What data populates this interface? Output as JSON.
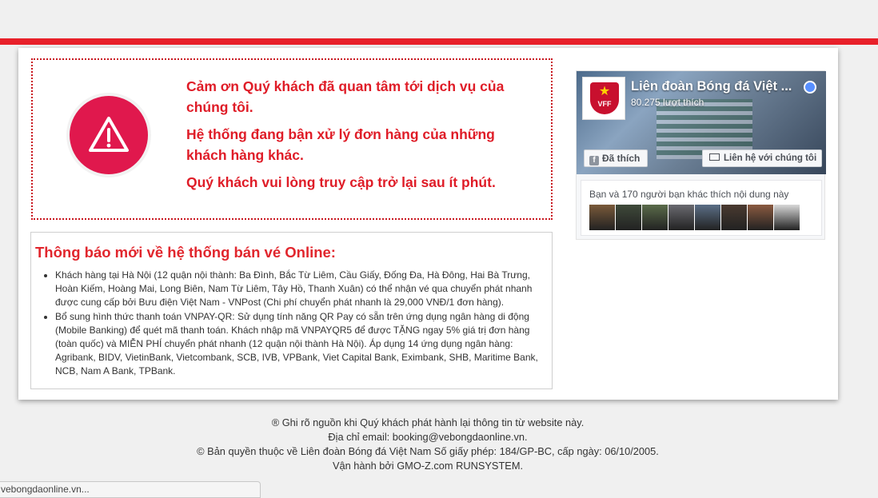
{
  "alert": {
    "line1": "Cảm ơn Quý khách đã quan tâm tới dịch vụ của chúng tôi.",
    "line2": "Hệ thống đang bận xử lý đơn hàng của những khách hàng khác.",
    "line3": "Quý khách vui lòng truy cập trở lại sau ít phút.",
    "icon": "warning-triangle-icon",
    "icon_color": "#e0184d",
    "text_color": "#df1c27"
  },
  "notice": {
    "title": "Thông báo mới về hệ thống bán vé Online:",
    "items": [
      "Khách hàng tại Hà Nội (12 quận nội thành: Ba Đình, Bắc Từ Liêm, Cầu Giấy, Đống Đa, Hà Đông, Hai Bà Trưng, Hoàn Kiếm, Hoàng Mai, Long Biên, Nam Từ Liêm, Tây Hồ, Thanh Xuân) có thể nhận vé qua chuyển phát nhanh được cung cấp bởi Bưu điện Việt Nam - VNPost (Chi phí chuyển phát nhanh là 29,000 VNĐ/1 đơn hàng).",
      "Bổ sung hình thức thanh toán VNPAY-QR: Sử dụng tính năng QR Pay có sẵn trên ứng dụng ngân hàng di động (Mobile Banking) để quét mã thanh toán. Khách nhập mã VNPAYQR5 để được TẶNG ngay 5% giá trị đơn hàng (toàn quốc) và MIỄN PHÍ chuyển phát nhanh (12 quận nội thành Hà Nội). Áp dụng 14 ứng dụng ngân hàng: Agribank, BIDV, VietinBank, Vietcombank, SCB, IVB, VPBank, Viet Capital Bank, Eximbank, SHB, Maritime Bank, NCB, Nam A Bank, TPBank."
    ]
  },
  "facebook": {
    "page_name": "Liên đoàn Bóng đá Việt ...",
    "likes": "80.275 lượt thích",
    "like_button": "Đã thích",
    "contact_button": "Liên hệ với chúng tôi",
    "friends_text": "Bạn và 170 người bạn khác thích nội dung này",
    "logo_text": "VFF",
    "avatar_colors": [
      "#7a5a3a",
      "#3f4a3a",
      "#5a6b4a",
      "#6a6a70",
      "#5b6e86",
      "#4a3a30",
      "#8a5a40",
      "#d8d8d8"
    ]
  },
  "footer": {
    "line1": "® Ghi rõ nguồn khi Quý khách phát hành lại thông tin từ website này.",
    "line2": "Địa chỉ email: booking@vebongdaonline.vn.",
    "line3": "© Bản quyền thuộc về Liên đoàn Bóng đá Việt Nam Số giấy phép: 184/GP-BC, cấp ngày: 06/10/2005.",
    "line4": "Vận hành bởi GMO-Z.com RUNSYSTEM."
  },
  "status_bar": {
    "text": "vebongdaonline.vn..."
  },
  "colors": {
    "brand_red": "#e8202a",
    "facebook_blue": "#5890ff"
  }
}
